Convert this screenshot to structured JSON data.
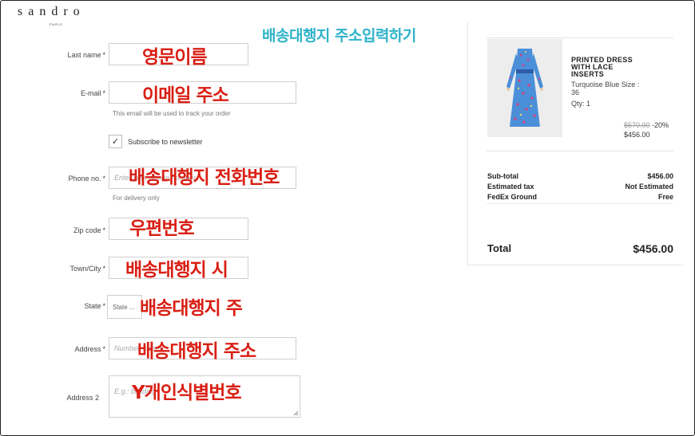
{
  "brand": {
    "name": "sandro",
    "sub": "PARIS"
  },
  "overlay_title": "배송대행지 주소입력하기",
  "form": {
    "last_name": {
      "label": "Last name",
      "required": "*",
      "value": "",
      "annotation": "영문이름"
    },
    "email": {
      "label": "E-mail",
      "required": "*",
      "value": "",
      "hint": "This email will be used to track your order",
      "annotation": "이메일 주소"
    },
    "newsletter": {
      "label": "Subscribe to newsletter",
      "checked": true,
      "check_glyph": "✓"
    },
    "phone": {
      "label": "Phone no.",
      "required": "*",
      "placeholder": "Enter your phone number",
      "hint": "For delivery only",
      "annotation": "배송대행지 전화번호"
    },
    "zip": {
      "label": "Zip code",
      "required": "*",
      "value": "",
      "annotation": "우편번호"
    },
    "city": {
      "label": "Town/City",
      "required": "*",
      "value": "",
      "annotation": "배송대행지 시"
    },
    "state": {
      "label": "State",
      "required": "*",
      "placeholder": "State ...",
      "annotation": "배송대행지 주"
    },
    "address": {
      "label": "Address",
      "required": "*",
      "placeholder": "Number, street",
      "annotation": "배송대행지 주소"
    },
    "address2": {
      "label": "Address 2",
      "placeholder": "E.g.: building",
      "annotation": "Y개인식별번호"
    }
  },
  "summary": {
    "product": {
      "name": "PRINTED DRESS WITH LACE INSERTS",
      "variant": "Turquoise Blue Size : 36",
      "qty": "Qty: 1",
      "old_price": "$570.00",
      "discount": "-20%",
      "price": "$456.00"
    },
    "rows": [
      {
        "label": "Sub-total",
        "value": "$456.00"
      },
      {
        "label": "Estimated tax",
        "value": "Not Estimated"
      },
      {
        "label": "FedEx Ground",
        "value": "Free"
      }
    ],
    "total_label": "Total",
    "total_value": "$456.00"
  },
  "colors": {
    "annotation": "#d91f14",
    "overlay_title": "#2fb3c9",
    "dress": "#4a8fd8"
  }
}
